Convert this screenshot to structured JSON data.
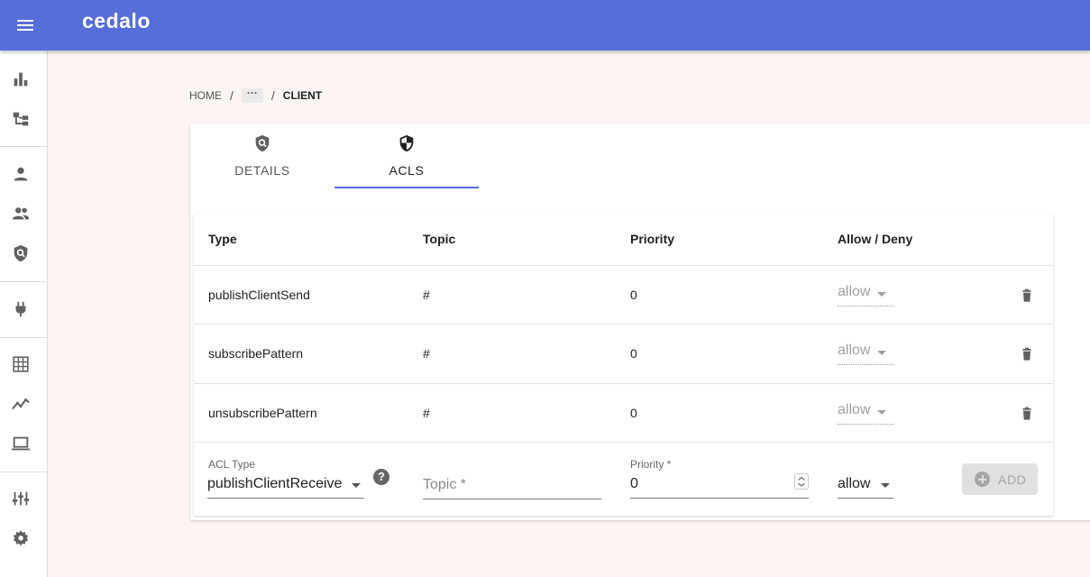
{
  "app": {
    "brand": "cedalo",
    "accent_color": "#566ed8"
  },
  "sidebar": {
    "icons": [
      "bar-chart-icon",
      "topology-icon",
      "person-icon",
      "people-icon",
      "shield-search-icon",
      "plug-icon",
      "grid-icon",
      "trend-line-icon",
      "laptop-icon",
      "tune-icon",
      "gear-icon"
    ]
  },
  "breadcrumb": {
    "home": "HOME",
    "ellipsis": "···",
    "current": "CLIENT"
  },
  "tabs": [
    {
      "label": "DETAILS",
      "icon": "shield-search-icon",
      "active": false
    },
    {
      "label": "ACLS",
      "icon": "shield-icon",
      "active": true
    }
  ],
  "acl_table": {
    "headers": [
      "Type",
      "Topic",
      "Priority",
      "Allow / Deny"
    ],
    "rows": [
      {
        "type": "publishClientSend",
        "topic": "#",
        "priority": "0",
        "permission": "allow"
      },
      {
        "type": "subscribePattern",
        "topic": "#",
        "priority": "0",
        "permission": "allow"
      },
      {
        "type": "unsubscribePattern",
        "topic": "#",
        "priority": "0",
        "permission": "allow"
      }
    ]
  },
  "new_acl": {
    "acl_type_label": "ACL Type",
    "acl_type_value": "publishClientReceive",
    "help": "?",
    "topic_placeholder": "Topic *",
    "priority_label": "Priority *",
    "priority_value": "0",
    "permission_value": "allow",
    "add_label": "ADD"
  }
}
